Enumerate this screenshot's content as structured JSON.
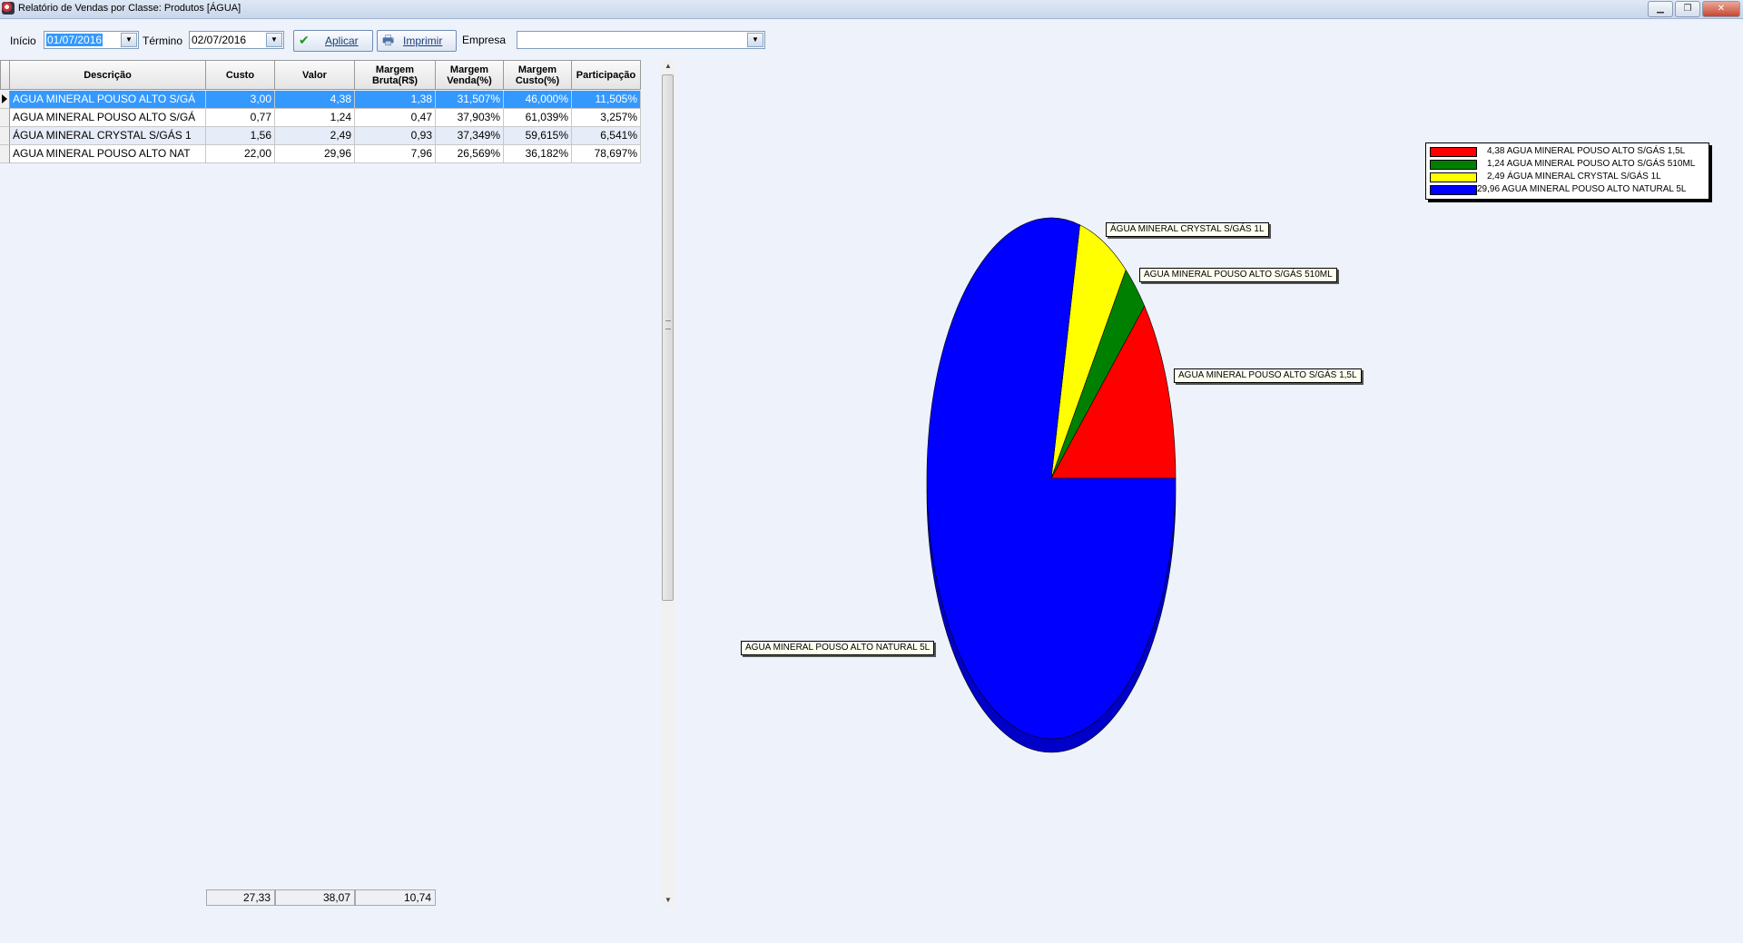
{
  "window": {
    "title": "Relatório de Vendas por Classe: Produtos [ÁGUA]",
    "minimize": "▁",
    "maximize": "❐",
    "close": "✕"
  },
  "toolbar": {
    "inicio_label": "Início",
    "inicio_value": "01/07/2016",
    "termino_label": "Término",
    "termino_value": "02/07/2016",
    "aplicar_label": "Aplicar",
    "imprimir_label": "Imprimir",
    "empresa_label": "Empresa",
    "empresa_value": ""
  },
  "grid": {
    "columns": [
      "Descrição",
      "Custo",
      "Valor",
      "Margem Bruta(R$)",
      "Margem Venda(%)",
      "Margem Custo(%)",
      "Participação"
    ],
    "rows": [
      [
        "AGUA MINERAL POUSO ALTO S/GÁ",
        "3,00",
        "4,38",
        "1,38",
        "31,507%",
        "46,000%",
        "11,505%"
      ],
      [
        "AGUA MINERAL POUSO ALTO S/GÁ",
        "0,77",
        "1,24",
        "0,47",
        "37,903%",
        "61,039%",
        "3,257%"
      ],
      [
        "ÁGUA MINERAL CRYSTAL S/GÁS 1",
        "1,56",
        "2,49",
        "0,93",
        "37,349%",
        "59,615%",
        "6,541%"
      ],
      [
        "AGUA MINERAL POUSO ALTO NAT",
        "22,00",
        "29,96",
        "7,96",
        "26,569%",
        "36,182%",
        "78,697%"
      ]
    ],
    "totals": [
      "27,33",
      "38,07",
      "10,74"
    ]
  },
  "chart_data": {
    "type": "pie",
    "title": "",
    "series": [
      {
        "label": "AGUA MINERAL POUSO ALTO S/GÁS 1,5L",
        "legend": "4,38 AGUA MINERAL POUSO ALTO S/GÁS 1,5L",
        "value": 4.38,
        "color": "#ff0000"
      },
      {
        "label": "AGUA MINERAL POUSO ALTO S/GÁS 510ML",
        "legend": "1,24 AGUA MINERAL POUSO ALTO S/GÁS 510ML",
        "value": 1.24,
        "color": "#008000"
      },
      {
        "label": "ÁGUA MINERAL CRYSTAL S/GÁS 1L",
        "legend": "2,49 ÁGUA MINERAL CRYSTAL S/GÁS 1L",
        "value": 2.49,
        "color": "#ffff00"
      },
      {
        "label": "AGUA MINERAL POUSO ALTO NATURAL 5L",
        "legend": "29,96 AGUA MINERAL POUSO ALTO NATURAL 5L",
        "value": 29.96,
        "color": "#0000ff"
      }
    ],
    "legend_position": "top-right"
  }
}
